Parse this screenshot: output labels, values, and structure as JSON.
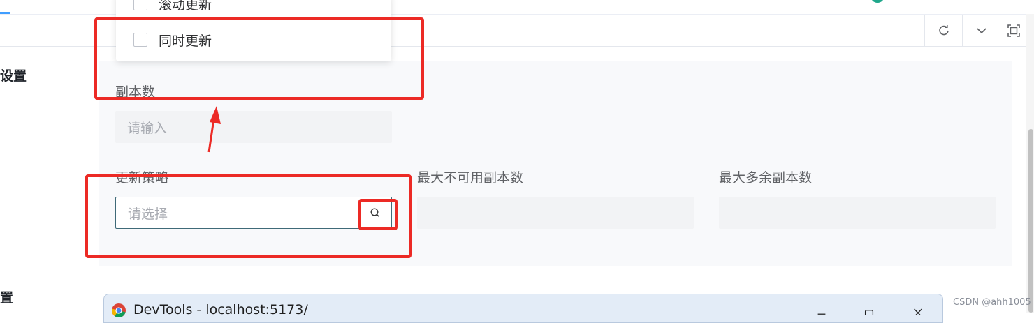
{
  "top_bar": {},
  "toolbar": {
    "icons": [
      "refresh-icon",
      "chevron-down-icon",
      "fullscreen-icon"
    ]
  },
  "sections": {
    "first_title": "设置",
    "second_title": "置"
  },
  "dropdown": {
    "items": [
      {
        "label": "滚动更新",
        "checked": false
      },
      {
        "label": "同时更新",
        "checked": false
      }
    ]
  },
  "form": {
    "replicas": {
      "label": "副本数",
      "placeholder": "请输入"
    },
    "update_strategy": {
      "label": "更新策略",
      "placeholder": "请选择"
    },
    "max_unavailable": {
      "label": "最大不可用副本数",
      "value": ""
    },
    "max_surge": {
      "label": "最大多余副本数",
      "value": ""
    }
  },
  "taskbar": {
    "window_title": "DevTools - localhost:5173/"
  },
  "watermark": "CSDN @ahh1005",
  "colors": {
    "annotation": "#ec2a25",
    "focus_border": "#3f6a78",
    "panel_bg": "#f8f9fb",
    "input_bg": "#f2f3f5",
    "accent_teal": "#1fa78b"
  }
}
